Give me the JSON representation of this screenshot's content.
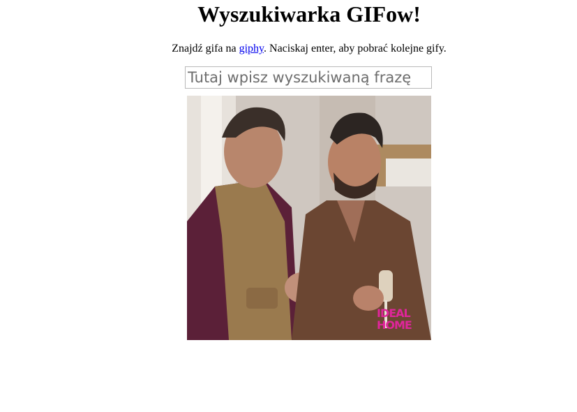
{
  "header": {
    "title": "Wyszukiwarka GIFow!"
  },
  "intro": {
    "before_link": "Znajdź gifa na ",
    "link_text": "giphy",
    "after_link": ". Naciskaj enter, aby pobrać kolejne gify."
  },
  "search": {
    "value": "",
    "placeholder": "Tutaj wpisz wyszukiwaną frazę"
  },
  "result": {
    "logo_line1": "IDEAL",
    "logo_line2": "HOME",
    "logo_color": "#e0259b"
  }
}
